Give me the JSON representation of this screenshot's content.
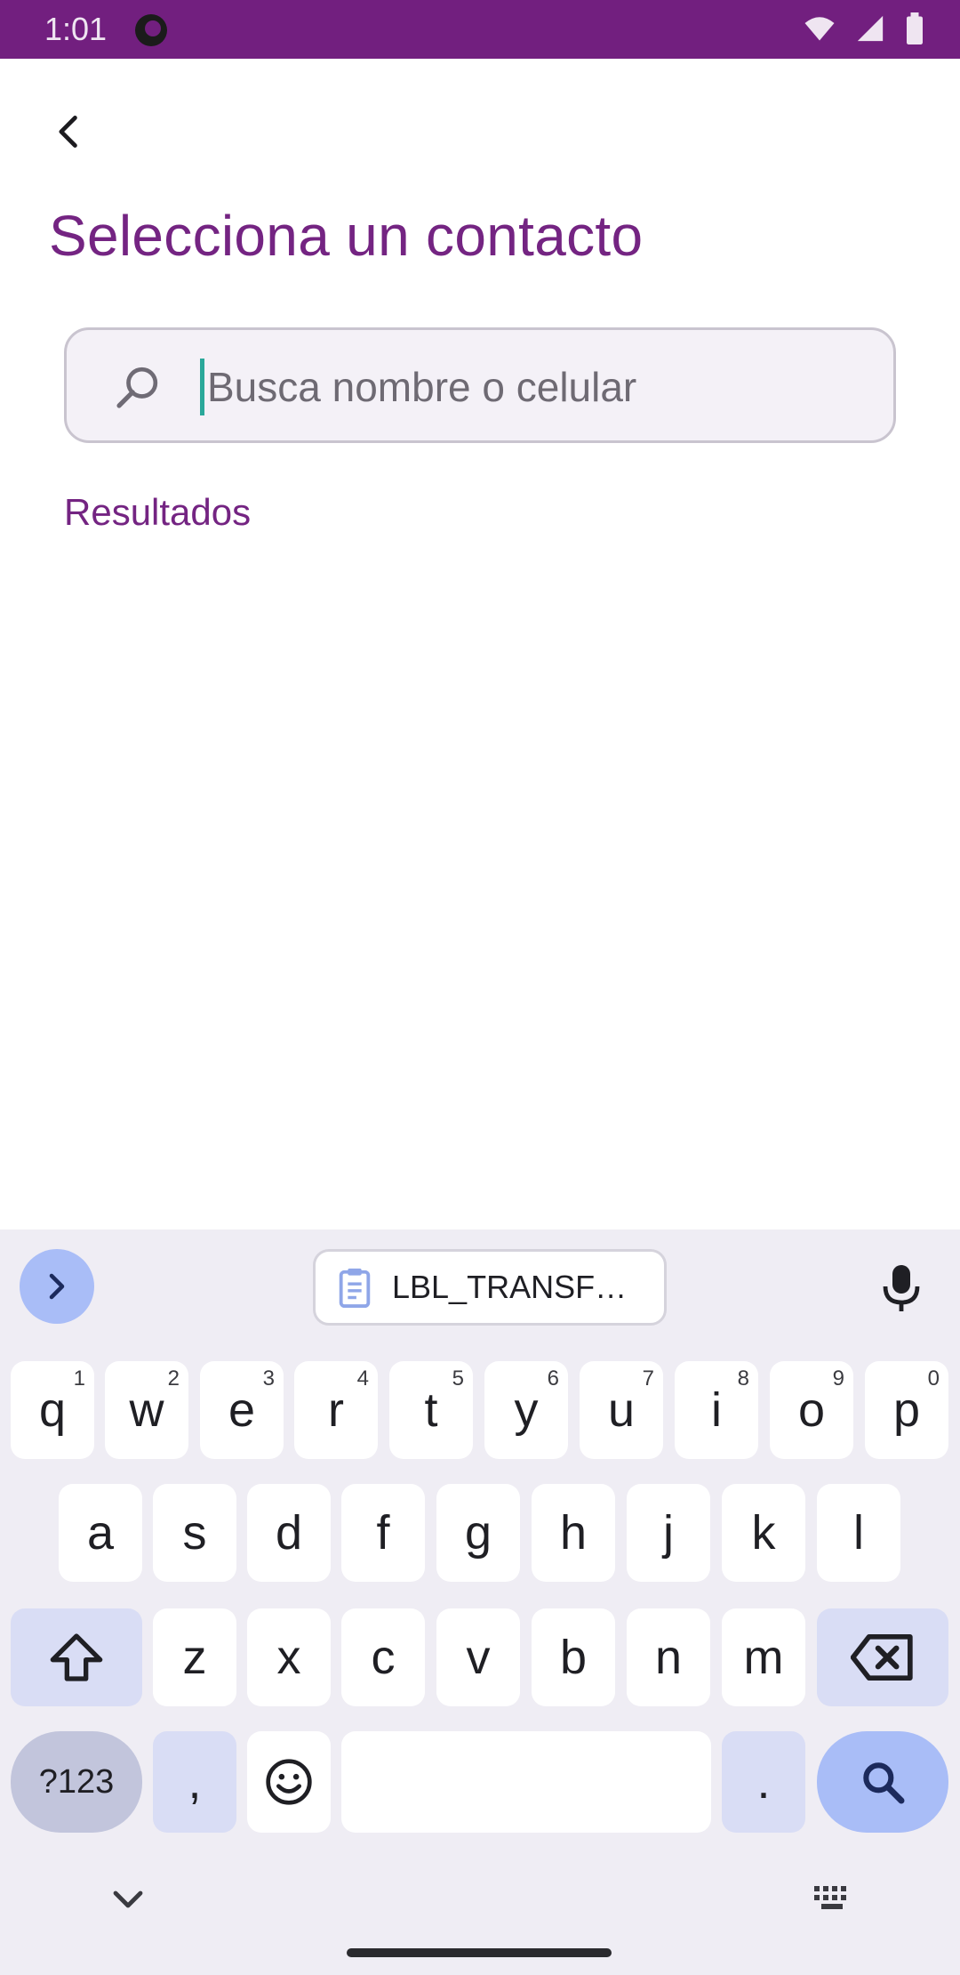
{
  "status_bar": {
    "time": "1:01",
    "color": "#721f7f"
  },
  "header": {
    "back_icon": "chevron-left-icon",
    "title": "Selecciona un contacto"
  },
  "search": {
    "placeholder": "Busca nombre o celular",
    "value": "",
    "icon": "search-icon"
  },
  "results": {
    "label": "Resultados",
    "items": []
  },
  "keyboard": {
    "clipboard_suggestion": "LBL_TRANSF…",
    "row1": [
      {
        "key": "q",
        "hint": "1"
      },
      {
        "key": "w",
        "hint": "2"
      },
      {
        "key": "e",
        "hint": "3"
      },
      {
        "key": "r",
        "hint": "4"
      },
      {
        "key": "t",
        "hint": "5"
      },
      {
        "key": "y",
        "hint": "6"
      },
      {
        "key": "u",
        "hint": "7"
      },
      {
        "key": "i",
        "hint": "8"
      },
      {
        "key": "o",
        "hint": "9"
      },
      {
        "key": "p",
        "hint": "0"
      }
    ],
    "row2": [
      "a",
      "s",
      "d",
      "f",
      "g",
      "h",
      "j",
      "k",
      "l"
    ],
    "row3": [
      "z",
      "x",
      "c",
      "v",
      "b",
      "n",
      "m"
    ],
    "symbols_label": "?123",
    "comma": ",",
    "period": "."
  },
  "colors": {
    "accent": "#742482",
    "keyboard_bg": "#efedf4",
    "action_key": "#a9bdf7"
  }
}
